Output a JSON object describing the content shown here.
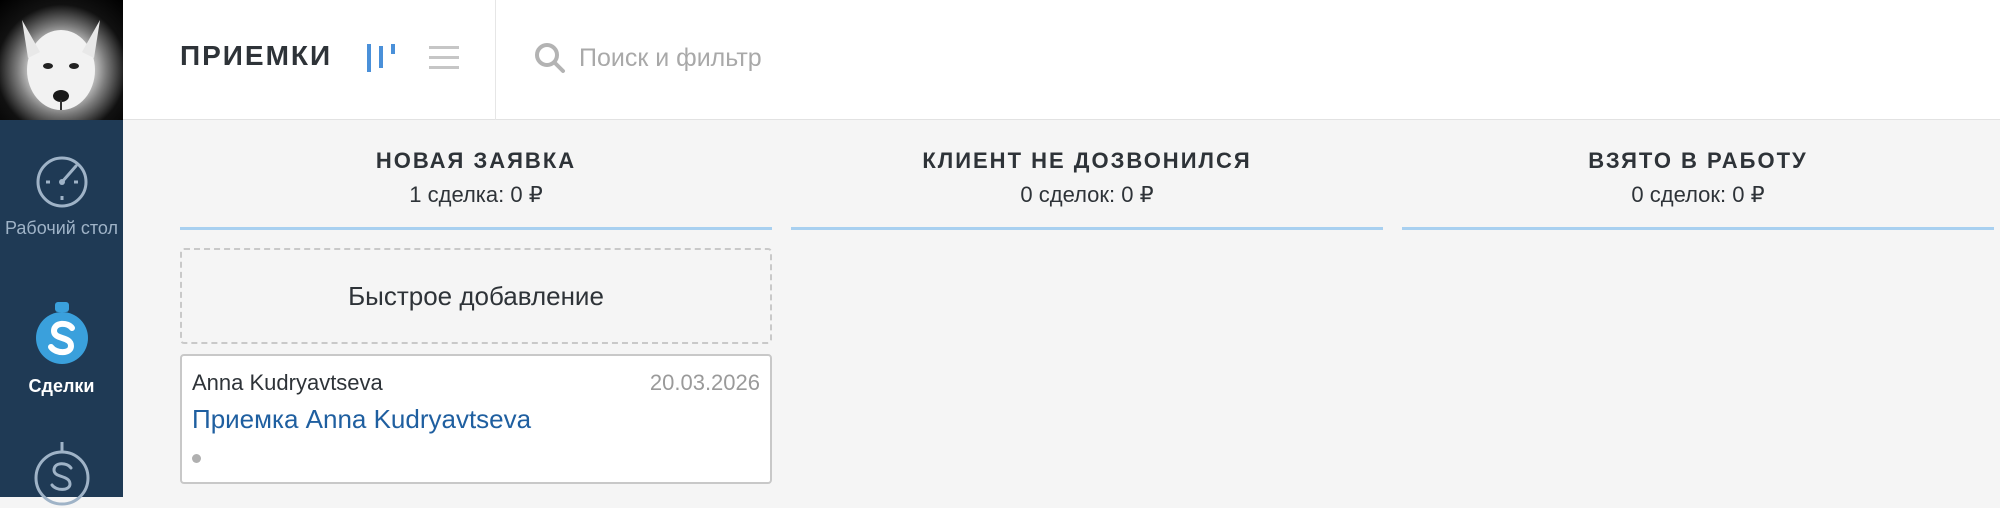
{
  "header": {
    "title": "ПРИЕМКИ",
    "search_placeholder": "Поиск и фильтр"
  },
  "sidebar": {
    "items": [
      {
        "label": "Рабочий стол",
        "icon": "dashboard-gauge-icon",
        "active": false
      },
      {
        "label": "Сделки",
        "icon": "deals-dollar-icon",
        "active": true
      },
      {
        "label": "",
        "icon": "dollar-icon",
        "active": false
      }
    ]
  },
  "columns": [
    {
      "title": "НОВАЯ ЗАЯВКА",
      "summary": "1 сделка: 0 ₽"
    },
    {
      "title": "КЛИЕНТ НЕ ДОЗВОНИЛСЯ",
      "summary": "0 сделок: 0 ₽"
    },
    {
      "title": "ВЗЯТО В РАБОТУ",
      "summary": "0 сделок: 0 ₽"
    }
  ],
  "quick_add_label": "Быстрое добавление",
  "deal": {
    "contact": "Anna Kudryavtseva",
    "date": "20.03.2026",
    "title": "Приемка Anna Kudryavtseva"
  },
  "colors": {
    "sidebar_bg": "#1f3a55",
    "accent_blue": "#4a90d9",
    "column_line": "#a8d0f0",
    "link": "#1f5fa0"
  }
}
